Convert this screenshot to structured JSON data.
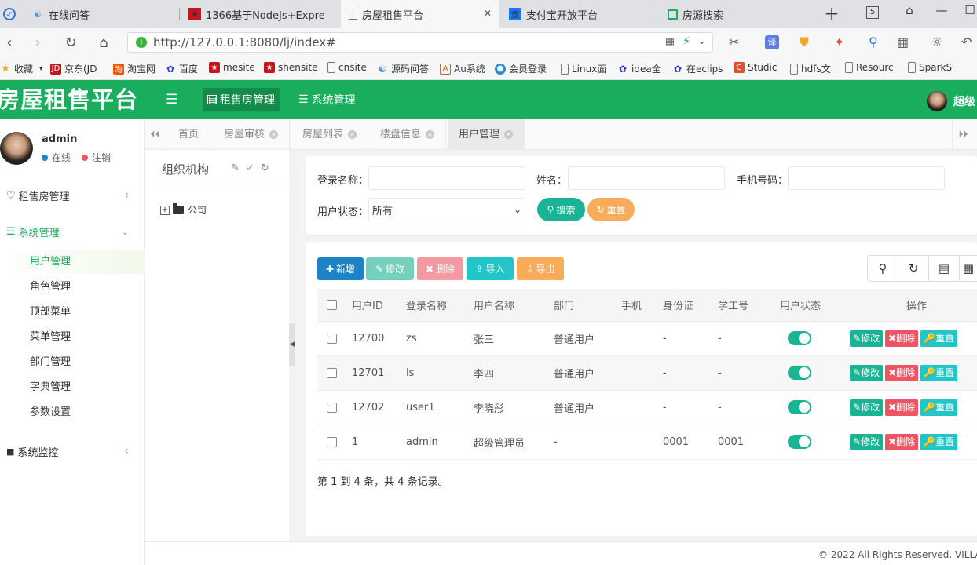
{
  "browser": {
    "tabs": [
      {
        "title": "在线问答",
        "icon": "ask-icon"
      },
      {
        "title": "1366基于NodeJs+Expre",
        "icon": "flag-icon"
      },
      {
        "title": "房屋租售平台",
        "icon": "page-icon"
      },
      {
        "title": "支付宝开放平台",
        "icon": "alipay-icon"
      },
      {
        "title": "房源搜索",
        "icon": "house-icon"
      }
    ],
    "tab_count": "5",
    "url": "http://127.0.0.1:8080/lj/index#",
    "bookmarks": [
      "收藏",
      "京东(JD",
      "淘宝网",
      "百度",
      "mesite",
      "shensite",
      "cnsite",
      "源码问答",
      "Au系统",
      "会员登录",
      "Linux面",
      "idea全",
      "在eclips",
      "Studic",
      "hdfs文",
      "Resourc",
      "SparkS"
    ]
  },
  "app": {
    "logo": "房屋租售平台",
    "top_menu": [
      {
        "label": "租售房管理"
      },
      {
        "label": "系统管理"
      }
    ],
    "header_user": "超级"
  },
  "sidebar": {
    "username": "admin",
    "status_online": "在线",
    "status_logout": "注销",
    "groups": [
      {
        "label": "租售房管理"
      },
      {
        "label": "系统管理"
      },
      {
        "label": "系统监控"
      }
    ],
    "items": [
      "用户管理",
      "角色管理",
      "顶部菜单",
      "菜单管理",
      "部门管理",
      "字典管理",
      "参数设置"
    ]
  },
  "content_tabs": [
    "首页",
    "房屋审核",
    "房屋列表",
    "楼盘信息",
    "用户管理"
  ],
  "org": {
    "title": "组织机构",
    "root_node": "公司"
  },
  "search": {
    "login_label": "登录名称：",
    "name_label": "姓名：",
    "phone_label": "手机号码：",
    "status_label": "用户状态：",
    "status_value": "所有",
    "search_btn": "搜索",
    "reset_btn": "重置"
  },
  "toolbar": {
    "add": "新增",
    "edit": "修改",
    "delete": "删除",
    "import": "导入",
    "export": "导出"
  },
  "table": {
    "headers": [
      "用户ID",
      "登录名称",
      "用户名称",
      "部门",
      "手机",
      "身份证",
      "学工号",
      "用户状态",
      "操作"
    ],
    "rows": [
      {
        "id": "12700",
        "login": "zs",
        "name": "张三",
        "dept": "普通用户",
        "phone": "",
        "idcard": "-",
        "stuno": "-"
      },
      {
        "id": "12701",
        "login": "ls",
        "name": "李四",
        "dept": "普通用户",
        "phone": "",
        "idcard": "-",
        "stuno": "-"
      },
      {
        "id": "12702",
        "login": "user1",
        "name": "李晓彤",
        "dept": "普通用户",
        "phone": "",
        "idcard": "-",
        "stuno": "-"
      },
      {
        "id": "1",
        "login": "admin",
        "name": "超级管理员",
        "dept": "-",
        "phone": "",
        "idcard": "0001",
        "stuno": "0001"
      }
    ],
    "row_actions": {
      "edit": "修改",
      "delete": "删除",
      "reset": "重置"
    },
    "footer": "第 1 到 4 条，共 4 条记录。"
  },
  "copyright": "© 2022 All Rights Reserved. VILLA",
  "colors": {
    "brand": "#1aad5e",
    "add": "#1c84c6",
    "edit": "#1ab394",
    "delete": "#ed5565",
    "import": "#23c6c8",
    "export": "#f8ac59"
  }
}
